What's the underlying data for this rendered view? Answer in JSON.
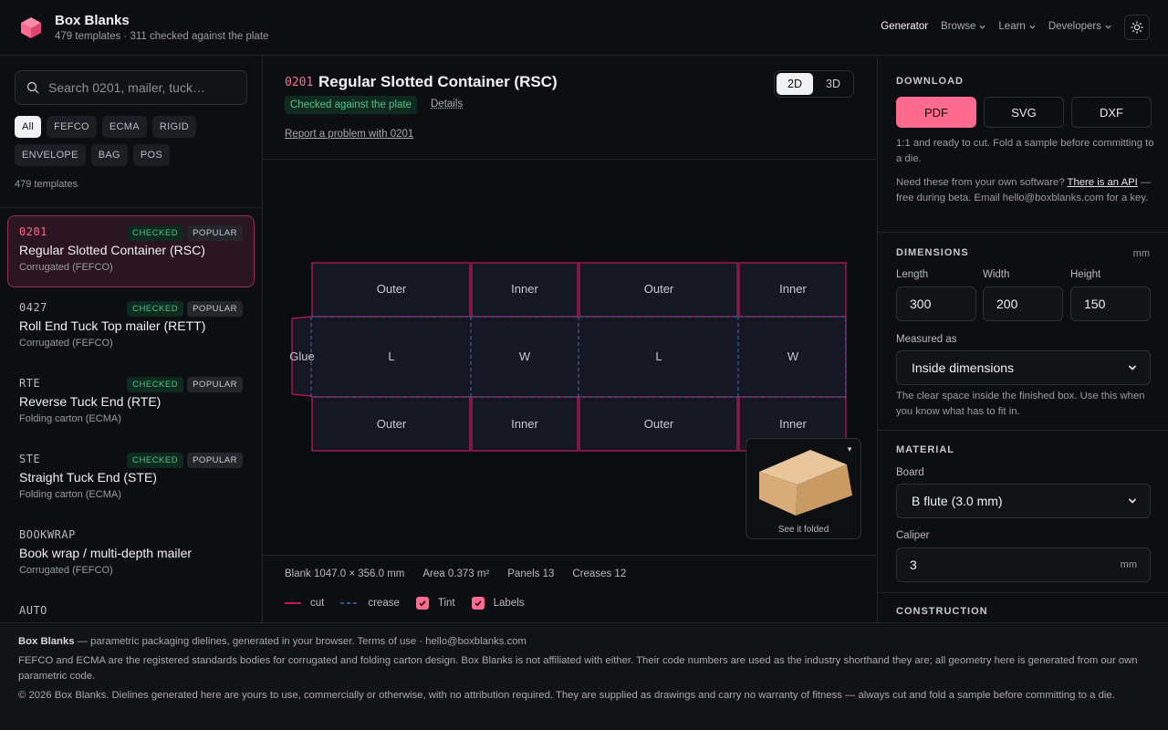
{
  "brand": {
    "title": "Box Blanks",
    "subtitle": "479 templates · 311 checked against the plate"
  },
  "nav": [
    {
      "label": "Generator",
      "dropdown": false,
      "active": true
    },
    {
      "label": "Browse",
      "dropdown": true
    },
    {
      "label": "Learn",
      "dropdown": true
    },
    {
      "label": "Developers",
      "dropdown": true
    }
  ],
  "sidebar": {
    "search_placeholder": "Search 0201, mailer, tuck…",
    "chips": [
      "All",
      "FEFCO",
      "ECMA",
      "RIGID",
      "ENVELOPE",
      "BAG",
      "POS"
    ],
    "active_chip": "All",
    "count": "479 templates",
    "items": [
      {
        "code": "0201",
        "name": "Regular Slotted Container (RSC)",
        "sub": "Corrugated (FEFCO)",
        "checked": "CHECKED",
        "popular": "POPULAR",
        "selected": true
      },
      {
        "code": "0427",
        "name": "Roll End Tuck Top mailer (RETT)",
        "sub": "Corrugated (FEFCO)",
        "checked": "CHECKED",
        "popular": "POPULAR"
      },
      {
        "code": "RTE",
        "name": "Reverse Tuck End (RTE)",
        "sub": "Folding carton (ECMA)",
        "checked": "CHECKED",
        "popular": "POPULAR"
      },
      {
        "code": "STE",
        "name": "Straight Tuck End (STE)",
        "sub": "Folding carton (ECMA)",
        "checked": "CHECKED",
        "popular": "POPULAR"
      },
      {
        "code": "BOOKWRAP",
        "name": "Book wrap / multi-depth mailer",
        "sub": "Corrugated (FEFCO)"
      },
      {
        "code": "AUTO",
        "name": "",
        "sub": ""
      }
    ]
  },
  "main": {
    "code": "0201",
    "title": "Regular Slotted Container (RSC)",
    "status": "Checked against the plate",
    "details": "Details",
    "report": "Report a problem with 0201",
    "view_2d": "2D",
    "view_3d": "3D",
    "panels": {
      "glue": "Glue",
      "top": [
        "Outer",
        "Inner",
        "Outer",
        "Inner"
      ],
      "middle": [
        "L",
        "W",
        "L",
        "W"
      ],
      "bottom": [
        "Outer",
        "Inner",
        "Outer",
        "Inner"
      ]
    },
    "preview_label": "See it folded",
    "stats": {
      "blank": "Blank 1047.0 × 356.0 mm",
      "area": "Area 0.373 m²",
      "panels": "Panels 13",
      "creases": "Creases 12"
    },
    "legend": {
      "cut": "cut",
      "crease": "crease",
      "tint": "Tint",
      "labels": "Labels"
    },
    "colors": {
      "cut": "#c2185b",
      "crease": "#3b6fb5",
      "accent": "#ff6b8e"
    }
  },
  "panel": {
    "download_h": "DOWNLOAD",
    "formats": [
      "PDF",
      "SVG",
      "DXF"
    ],
    "active_format": "PDF",
    "download_note": "1:1 and ready to cut. Fold a sample before committing to a die.",
    "api_pre": "Need these from your own software? ",
    "api_link": "There is an API",
    "api_post": " — free during beta. Email hello@boxblanks.com for a key.",
    "dimensions_h": "DIMENSIONS",
    "unit": "mm",
    "length_label": "Length",
    "length": "300",
    "width_label": "Width",
    "width": "200",
    "height_label": "Height",
    "height": "150",
    "measured_label": "Measured as",
    "measured": "Inside dimensions",
    "measured_note": "The clear space inside the finished box. Use this when you know what has to fit in.",
    "material_h": "MATERIAL",
    "board_label": "Board",
    "board": "B flute (3.0 mm)",
    "caliper_label": "Caliper",
    "caliper": "3",
    "caliper_unit": "mm",
    "construction_h": "CONSTRUCTION"
  },
  "footer": {
    "brand": "Box Blanks",
    "line1": " — parametric packaging dielines, generated in your browser. Terms of use · hello@boxblanks.com",
    "line2": "FEFCO and ECMA are the registered standards bodies for corrugated and folding carton design. Box Blanks is not affiliated with either. Their code numbers are used as the industry shorthand they are; all geometry here is generated from our own parametric code.",
    "line3": "© 2026 Box Blanks. Dielines generated here are yours to use, commercially or otherwise, with no attribution required. They are supplied as drawings and carry no warranty of fitness — always cut and fold a sample before committing to a die."
  }
}
